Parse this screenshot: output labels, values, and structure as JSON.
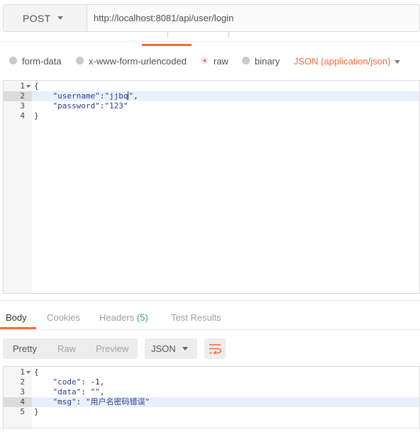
{
  "request": {
    "method": "POST",
    "url": "http://localhost:8081/api/user/login"
  },
  "body_types": {
    "options": [
      {
        "label": "form-data",
        "selected": false
      },
      {
        "label": "x-www-form-urlencoded",
        "selected": false
      },
      {
        "label": "raw",
        "selected": true
      },
      {
        "label": "binary",
        "selected": false
      }
    ],
    "content_type": "JSON (application/json)"
  },
  "request_body": {
    "lines": [
      {
        "num": "1",
        "text": "{"
      },
      {
        "num": "2",
        "key": "\"username\"",
        "sep": ":",
        "value": "\"jjbq\"",
        "tail": ","
      },
      {
        "num": "3",
        "key": "\"password\"",
        "sep": ":",
        "value": "\"123\"",
        "tail": ""
      },
      {
        "num": "4",
        "text": "}"
      }
    ]
  },
  "response_tabs": {
    "body": "Body",
    "cookies": "Cookies",
    "headers": "Headers",
    "headers_count": "(5)",
    "test_results": "Test Results"
  },
  "format_toolbar": {
    "pretty": "Pretty",
    "raw": "Raw",
    "preview": "Preview",
    "language": "JSON"
  },
  "response_body": {
    "lines": [
      {
        "num": "1",
        "text": "{"
      },
      {
        "num": "2",
        "key": "\"code\"",
        "sep": ": ",
        "value": "-1",
        "tail": ","
      },
      {
        "num": "3",
        "key": "\"data\"",
        "sep": ": ",
        "value": "\"\"",
        "tail": ","
      },
      {
        "num": "4",
        "key": "\"msg\"",
        "sep": ": ",
        "value": "\"用户名密码错误\"",
        "tail": ""
      },
      {
        "num": "5",
        "text": "}"
      }
    ]
  },
  "colors": {
    "accent": "#f26b3a",
    "badge": "#3aa757",
    "json_string": "#2a3b8f"
  }
}
